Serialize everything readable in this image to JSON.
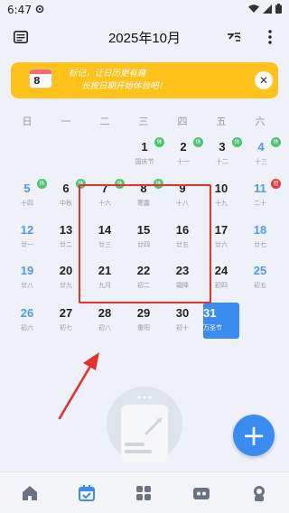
{
  "status_bar": {
    "time": "6:47"
  },
  "header": {
    "title": "2025年10月"
  },
  "banner": {
    "card_number": "8",
    "line1": "标记，让日历更有趣",
    "line2": "长按日期开始体验吧！"
  },
  "weekdays": [
    "日",
    "一",
    "二",
    "三",
    "四",
    "五",
    "六"
  ],
  "days": {
    "d1": {
      "num": "1",
      "sub": "国庆节",
      "badge": "休"
    },
    "d2": {
      "num": "2",
      "sub": "十一",
      "badge": "休"
    },
    "d3": {
      "num": "3",
      "sub": "十二",
      "badge": "休"
    },
    "d4": {
      "num": "4",
      "sub": "十三",
      "badge": "休"
    },
    "d5": {
      "num": "5",
      "sub": "十四",
      "badge": "休"
    },
    "d6": {
      "num": "6",
      "sub": "中秋",
      "badge": "休"
    },
    "d7": {
      "num": "7",
      "sub": "十六",
      "badge": "休"
    },
    "d8": {
      "num": "8",
      "sub": "寒露",
      "badge": "休"
    },
    "d9": {
      "num": "9",
      "sub": "十八"
    },
    "d10": {
      "num": "10",
      "sub": "十九"
    },
    "d11": {
      "num": "11",
      "sub": "二十",
      "badge": "班"
    },
    "d12": {
      "num": "12",
      "sub": "廿一"
    },
    "d13": {
      "num": "13",
      "sub": "廿二"
    },
    "d14": {
      "num": "14",
      "sub": "廿三"
    },
    "d15": {
      "num": "15",
      "sub": "廿四"
    },
    "d16": {
      "num": "16",
      "sub": "廿五"
    },
    "d17": {
      "num": "17",
      "sub": "廿六"
    },
    "d18": {
      "num": "18",
      "sub": "廿七"
    },
    "d19": {
      "num": "19",
      "sub": "廿八"
    },
    "d20": {
      "num": "20",
      "sub": "廿九"
    },
    "d21": {
      "num": "21",
      "sub": "九月"
    },
    "d22": {
      "num": "22",
      "sub": "初二"
    },
    "d23": {
      "num": "23",
      "sub": "霜降"
    },
    "d24": {
      "num": "24",
      "sub": "初四"
    },
    "d25": {
      "num": "25",
      "sub": "初五"
    },
    "d26": {
      "num": "26",
      "sub": "初六"
    },
    "d27": {
      "num": "27",
      "sub": "初七"
    },
    "d28": {
      "num": "28",
      "sub": "初八"
    },
    "d29": {
      "num": "29",
      "sub": "重阳"
    },
    "d30": {
      "num": "30",
      "sub": "初十"
    },
    "d31": {
      "num": "31",
      "sub": "万圣节"
    }
  },
  "fab": {
    "label": "+"
  },
  "colors": {
    "accent": "#3b8cf2",
    "banner": "#ffc21a",
    "holiday_badge": "#4cc46e",
    "work_badge": "#e53935",
    "highlight_box": "#e5302c"
  },
  "icons": [
    "list-icon",
    "weather-icon",
    "more-icon",
    "home-icon",
    "calendar-icon",
    "grid-icon",
    "tools-icon",
    "profile-icon"
  ]
}
